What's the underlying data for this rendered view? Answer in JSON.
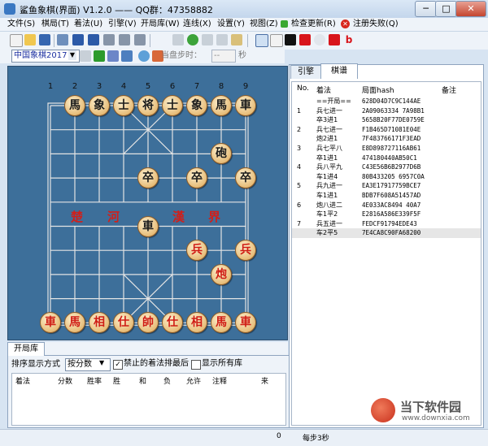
{
  "window": {
    "title": "鲨鱼象棋(界面) V1.2.0  —— QQ群：47358882",
    "min": "─",
    "max": "□",
    "close": "✕"
  },
  "menu": [
    "文件(S)",
    "棋局(T)",
    "着法(U)",
    "引擎(V)",
    "开局库(W)",
    "连线(X)",
    "设置(Y)",
    "视图(Z)",
    "检查更新(R)",
    "注册失败(Q)"
  ],
  "toolbar2": {
    "variant": "中国象棋2017",
    "time_label": "当盘步时：",
    "time_value": "--",
    "sec_label": "秒"
  },
  "board": {
    "col_numbers": [
      "1",
      "2",
      "3",
      "4",
      "5",
      "6",
      "7",
      "8",
      "9"
    ],
    "river_left_1": "楚",
    "river_left_2": "河",
    "river_right_1": "漢",
    "river_right_2": "界",
    "pieces": [
      {
        "t": "馬",
        "c": "black",
        "col": 1,
        "row": 0
      },
      {
        "t": "象",
        "c": "black",
        "col": 2,
        "row": 0
      },
      {
        "t": "士",
        "c": "black",
        "col": 3,
        "row": 0
      },
      {
        "t": "将",
        "c": "black",
        "col": 4,
        "row": 0
      },
      {
        "t": "士",
        "c": "black",
        "col": 5,
        "row": 0
      },
      {
        "t": "象",
        "c": "black",
        "col": 6,
        "row": 0
      },
      {
        "t": "馬",
        "c": "black",
        "col": 7,
        "row": 0
      },
      {
        "t": "車",
        "c": "black",
        "col": 8,
        "row": 0
      },
      {
        "t": "砲",
        "c": "black",
        "col": 7,
        "row": 2
      },
      {
        "t": "卒",
        "c": "black",
        "col": 4,
        "row": 3
      },
      {
        "t": "卒",
        "c": "black",
        "col": 6,
        "row": 3
      },
      {
        "t": "卒",
        "c": "black",
        "col": 8,
        "row": 3
      },
      {
        "t": "車",
        "c": "black",
        "col": 4,
        "row": 5
      },
      {
        "t": "兵",
        "c": "red",
        "col": 6,
        "row": 6
      },
      {
        "t": "兵",
        "c": "red",
        "col": 8,
        "row": 6
      },
      {
        "t": "炮",
        "c": "red",
        "col": 7,
        "row": 7
      },
      {
        "t": "車",
        "c": "red",
        "col": 0,
        "row": 9
      },
      {
        "t": "馬",
        "c": "red",
        "col": 1,
        "row": 9
      },
      {
        "t": "相",
        "c": "red",
        "col": 2,
        "row": 9
      },
      {
        "t": "仕",
        "c": "red",
        "col": 3,
        "row": 9
      },
      {
        "t": "帥",
        "c": "red",
        "col": 4,
        "row": 9
      },
      {
        "t": "仕",
        "c": "red",
        "col": 5,
        "row": 9
      },
      {
        "t": "相",
        "c": "red",
        "col": 6,
        "row": 9
      },
      {
        "t": "馬",
        "c": "red",
        "col": 7,
        "row": 9
      },
      {
        "t": "車",
        "c": "red",
        "col": 8,
        "row": 9
      }
    ]
  },
  "right_panel": {
    "tab_engine": "引擎",
    "tab_record": "棋谱",
    "headers": {
      "no": "No.",
      "move": "着法",
      "hash": "局面hash",
      "note": "备注"
    },
    "rows": [
      {
        "no": "",
        "move": "==开局==",
        "hash": "628D04D7C9C144AE"
      },
      {
        "no": "1",
        "move": "兵七进一",
        "hash": "2A09063334 7A98B1"
      },
      {
        "no": "",
        "move": "卒3进1",
        "hash": "5658B20F77DE0759E"
      },
      {
        "no": "2",
        "move": "兵七进一",
        "hash": "F1B465D71081E04E"
      },
      {
        "no": "",
        "move": "炮2进1",
        "hash": "7F483766171F3EAD"
      },
      {
        "no": "3",
        "move": "兵七平八",
        "hash": "E8D898727116AB61"
      },
      {
        "no": "",
        "move": "卒1进1",
        "hash": "474180440AB50C1"
      },
      {
        "no": "4",
        "move": "兵八平九",
        "hash": "C43E56B6B2977D6B"
      },
      {
        "no": "",
        "move": "车1进4",
        "hash": "80B433205 6957C0A"
      },
      {
        "no": "5",
        "move": "兵九进一",
        "hash": "EA3E17917759BCE7"
      },
      {
        "no": "",
        "move": "车1进1",
        "hash": "BDB7F608A51457AD"
      },
      {
        "no": "6",
        "move": "炮八进二",
        "hash": "4E033AC8494 40A7"
      },
      {
        "no": "",
        "move": "车1平2",
        "hash": "E2816A586E339F5F"
      },
      {
        "no": "7",
        "move": "兵五进一",
        "hash": "FEDCF91794EDE43"
      },
      {
        "no": "",
        "move": "车2平5",
        "hash": "7E4CA8C90FA68200"
      }
    ]
  },
  "opening_panel": {
    "tab": "开局库",
    "sort_label": "排序显示方式",
    "sort_value": "按分数",
    "chk_forbid_label": "禁止的着法排最后",
    "chk_forbid_mark": "✓",
    "chk_all_label": "显示所有库",
    "columns": [
      "着法",
      "分数",
      "胜率",
      "胜",
      "和",
      "负",
      "允许",
      "注释",
      "来"
    ]
  },
  "status": {
    "count": "0",
    "steps": "每步3秒"
  },
  "watermark": {
    "line1": "当下软件园",
    "line2": "www.downxia.com"
  },
  "colors": {
    "red_piece": "#cf1c14",
    "black_piece": "#1a1a1a",
    "board_bg": "#3d6f9a"
  }
}
